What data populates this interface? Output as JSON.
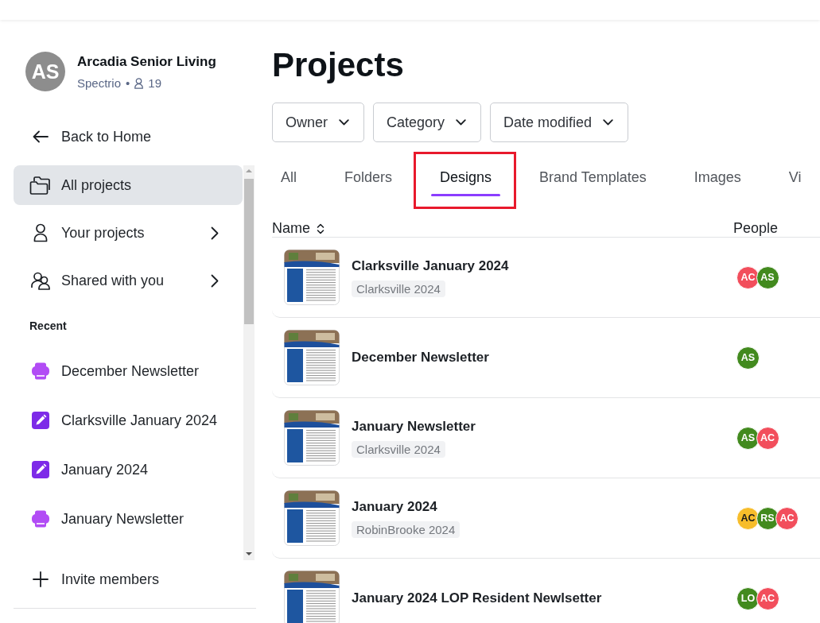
{
  "workspace": {
    "initials": "AS",
    "name": "Arcadia Senior Living",
    "team": "Spectrio",
    "separator": "•",
    "member_count": "19"
  },
  "back_link": {
    "label": "Back to Home"
  },
  "nav": [
    {
      "label": "All projects",
      "selected": true,
      "expandable": false
    },
    {
      "label": "Your projects",
      "selected": false,
      "expandable": true
    },
    {
      "label": "Shared with you",
      "selected": false,
      "expandable": true
    }
  ],
  "recent": {
    "heading": "Recent",
    "items": [
      {
        "label": "December Newsletter",
        "kind": "print"
      },
      {
        "label": "Clarksville January 2024",
        "kind": "document"
      },
      {
        "label": "January 2024",
        "kind": "document"
      },
      {
        "label": "January Newsletter",
        "kind": "print"
      }
    ]
  },
  "invite": {
    "label": "Invite members"
  },
  "page_title": "Projects",
  "filters": [
    {
      "label": "Owner"
    },
    {
      "label": "Category"
    },
    {
      "label": "Date modified"
    }
  ],
  "tabs": [
    {
      "label": "All",
      "selected": false,
      "highlighted": false
    },
    {
      "label": "Folders",
      "selected": false,
      "highlighted": false
    },
    {
      "label": "Designs",
      "selected": true,
      "highlighted": true
    },
    {
      "label": "Brand Templates",
      "selected": false,
      "highlighted": false
    },
    {
      "label": "Images",
      "selected": false,
      "highlighted": false
    },
    {
      "label": "Vi",
      "selected": false,
      "highlighted": false
    }
  ],
  "table": {
    "columns": [
      {
        "label": "Name",
        "sortable": true
      },
      {
        "label": "People",
        "sortable": false
      }
    ],
    "rows": [
      {
        "title": "Clarksville January 2024",
        "tag": "Clarksville 2024",
        "people": [
          {
            "initials": "AC",
            "color": "#f24e5c"
          },
          {
            "initials": "AS",
            "color": "#428a1e"
          }
        ]
      },
      {
        "title": "December Newsletter",
        "people": [
          {
            "initials": "AS",
            "color": "#428a1e"
          }
        ]
      },
      {
        "title": "January Newsletter",
        "tag": "Clarksville 2024",
        "people": [
          {
            "initials": "AS",
            "color": "#428a1e"
          },
          {
            "initials": "AC",
            "color": "#f24e5c"
          }
        ]
      },
      {
        "title": "January 2024",
        "tag": "RobinBrooke 2024",
        "people": [
          {
            "initials": "AC",
            "color": "#f7bd2b"
          },
          {
            "initials": "RS",
            "color": "#428a1e"
          },
          {
            "initials": "AC",
            "color": "#f24e5c"
          }
        ]
      },
      {
        "title": "January 2024 LOP Resident Newlsetter",
        "people": [
          {
            "initials": "LO",
            "color": "#428a1e"
          },
          {
            "initials": "AC",
            "color": "#f24e5c"
          }
        ]
      }
    ]
  }
}
